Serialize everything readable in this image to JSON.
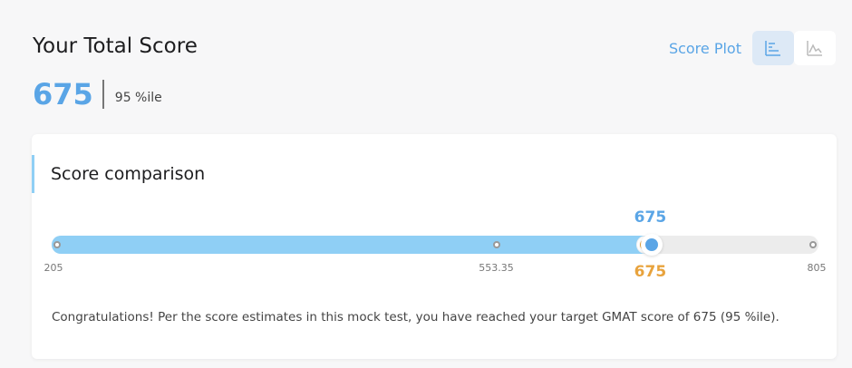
{
  "header": {
    "title": "Your Total Score",
    "score": "675",
    "percentile": "95 %ile"
  },
  "toolbar": {
    "plot_label": "Score Plot",
    "active_view": "bar-chart",
    "colors": {
      "accent": "#5aa5e6",
      "target": "#e8a33d",
      "fill": "#8fcff5"
    }
  },
  "comparison": {
    "title": "Score comparison",
    "min": 205,
    "mid": 553.35,
    "max": 805,
    "min_label": "205",
    "mid_label": "553.35",
    "max_label": "805",
    "your_score": 675,
    "your_score_label": "675",
    "target_score": 675,
    "target_score_label": "675",
    "message": "Congratulations! Per the score estimates in this mock test, you have reached your target GMAT score of 675 (95 %ile)."
  }
}
